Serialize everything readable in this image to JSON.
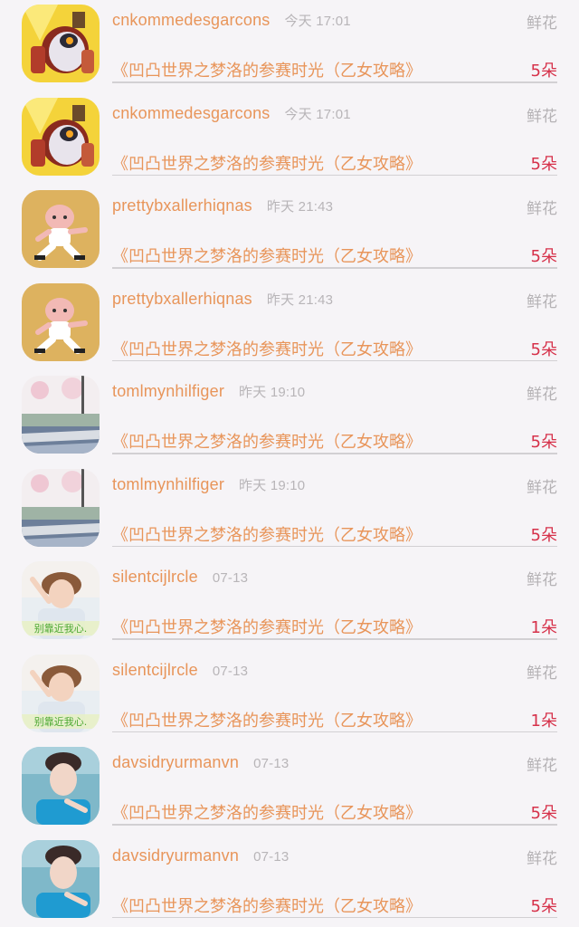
{
  "rows": [
    {
      "user": "cnkommedesgarcons",
      "time": "今天 17:01",
      "type": "鲜花",
      "title": "《凹凸世界之梦洛的参赛时光（乙女攻略》",
      "amount": "5朵",
      "avatar": "robot-avatar"
    },
    {
      "user": "cnkommedesgarcons",
      "time": "今天 17:01",
      "type": "鲜花",
      "title": "《凹凸世界之梦洛的参赛时光（乙女攻略》",
      "amount": "5朵",
      "avatar": "robot-avatar"
    },
    {
      "user": "prettybxallerhiqnas",
      "time": "昨天 21:43",
      "type": "鲜花",
      "title": "《凹凸世界之梦洛的参赛时光（乙女攻略》",
      "amount": "5朵",
      "avatar": "cartoon-kungfu-avatar"
    },
    {
      "user": "prettybxallerhiqnas",
      "time": "昨天 21:43",
      "type": "鲜花",
      "title": "《凹凸世界之梦洛的参赛时光（乙女攻略》",
      "amount": "5朵",
      "avatar": "cartoon-kungfu-avatar"
    },
    {
      "user": "tomlmynhilfiger",
      "time": "昨天 19:10",
      "type": "鲜花",
      "title": "《凹凸世界之梦洛的参赛时光（乙女攻略》",
      "amount": "5朵",
      "avatar": "street-scene-avatar"
    },
    {
      "user": "tomlmynhilfiger",
      "time": "昨天 19:10",
      "type": "鲜花",
      "title": "《凹凸世界之梦洛的参赛时光（乙女攻略》",
      "amount": "5朵",
      "avatar": "street-scene-avatar"
    },
    {
      "user": "silentcijlrcle",
      "time": "07-13",
      "type": "鲜花",
      "title": "《凹凸世界之梦洛的参赛时光（乙女攻略》",
      "amount": "1朵",
      "avatar": "girl-photo-avatar",
      "avatar_caption": "别靠近我心."
    },
    {
      "user": "silentcijlrcle",
      "time": "07-13",
      "type": "鲜花",
      "title": "《凹凸世界之梦洛的参赛时光（乙女攻略》",
      "amount": "1朵",
      "avatar": "girl-photo-avatar",
      "avatar_caption": "别靠近我心."
    },
    {
      "user": "davsidryurmanvn",
      "time": "07-13",
      "type": "鲜花",
      "title": "《凹凸世界之梦洛的参赛时光（乙女攻略》",
      "amount": "5朵",
      "avatar": "boy-photo-avatar"
    },
    {
      "user": "davsidryurmanvn",
      "time": "07-13",
      "type": "鲜花",
      "title": "《凹凸世界之梦洛的参赛时光（乙女攻略》",
      "amount": "5朵",
      "avatar": "boy-photo-avatar"
    }
  ],
  "colors": {
    "username": "#e8955a",
    "time": "#b8b5b8",
    "amount": "#d6314a",
    "background": "#f6f4f7"
  }
}
